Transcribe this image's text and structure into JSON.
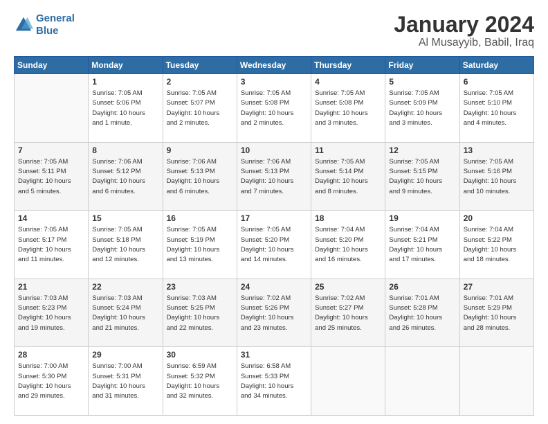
{
  "header": {
    "logo_line1": "General",
    "logo_line2": "Blue",
    "title": "January 2024",
    "subtitle": "Al Musayyib, Babil, Iraq"
  },
  "weekdays": [
    "Sunday",
    "Monday",
    "Tuesday",
    "Wednesday",
    "Thursday",
    "Friday",
    "Saturday"
  ],
  "weeks": [
    [
      {
        "day": "",
        "info": ""
      },
      {
        "day": "1",
        "info": "Sunrise: 7:05 AM\nSunset: 5:06 PM\nDaylight: 10 hours\nand 1 minute."
      },
      {
        "day": "2",
        "info": "Sunrise: 7:05 AM\nSunset: 5:07 PM\nDaylight: 10 hours\nand 2 minutes."
      },
      {
        "day": "3",
        "info": "Sunrise: 7:05 AM\nSunset: 5:08 PM\nDaylight: 10 hours\nand 2 minutes."
      },
      {
        "day": "4",
        "info": "Sunrise: 7:05 AM\nSunset: 5:08 PM\nDaylight: 10 hours\nand 3 minutes."
      },
      {
        "day": "5",
        "info": "Sunrise: 7:05 AM\nSunset: 5:09 PM\nDaylight: 10 hours\nand 3 minutes."
      },
      {
        "day": "6",
        "info": "Sunrise: 7:05 AM\nSunset: 5:10 PM\nDaylight: 10 hours\nand 4 minutes."
      }
    ],
    [
      {
        "day": "7",
        "info": "Sunrise: 7:05 AM\nSunset: 5:11 PM\nDaylight: 10 hours\nand 5 minutes."
      },
      {
        "day": "8",
        "info": "Sunrise: 7:06 AM\nSunset: 5:12 PM\nDaylight: 10 hours\nand 6 minutes."
      },
      {
        "day": "9",
        "info": "Sunrise: 7:06 AM\nSunset: 5:13 PM\nDaylight: 10 hours\nand 6 minutes."
      },
      {
        "day": "10",
        "info": "Sunrise: 7:06 AM\nSunset: 5:13 PM\nDaylight: 10 hours\nand 7 minutes."
      },
      {
        "day": "11",
        "info": "Sunrise: 7:05 AM\nSunset: 5:14 PM\nDaylight: 10 hours\nand 8 minutes."
      },
      {
        "day": "12",
        "info": "Sunrise: 7:05 AM\nSunset: 5:15 PM\nDaylight: 10 hours\nand 9 minutes."
      },
      {
        "day": "13",
        "info": "Sunrise: 7:05 AM\nSunset: 5:16 PM\nDaylight: 10 hours\nand 10 minutes."
      }
    ],
    [
      {
        "day": "14",
        "info": "Sunrise: 7:05 AM\nSunset: 5:17 PM\nDaylight: 10 hours\nand 11 minutes."
      },
      {
        "day": "15",
        "info": "Sunrise: 7:05 AM\nSunset: 5:18 PM\nDaylight: 10 hours\nand 12 minutes."
      },
      {
        "day": "16",
        "info": "Sunrise: 7:05 AM\nSunset: 5:19 PM\nDaylight: 10 hours\nand 13 minutes."
      },
      {
        "day": "17",
        "info": "Sunrise: 7:05 AM\nSunset: 5:20 PM\nDaylight: 10 hours\nand 14 minutes."
      },
      {
        "day": "18",
        "info": "Sunrise: 7:04 AM\nSunset: 5:20 PM\nDaylight: 10 hours\nand 16 minutes."
      },
      {
        "day": "19",
        "info": "Sunrise: 7:04 AM\nSunset: 5:21 PM\nDaylight: 10 hours\nand 17 minutes."
      },
      {
        "day": "20",
        "info": "Sunrise: 7:04 AM\nSunset: 5:22 PM\nDaylight: 10 hours\nand 18 minutes."
      }
    ],
    [
      {
        "day": "21",
        "info": "Sunrise: 7:03 AM\nSunset: 5:23 PM\nDaylight: 10 hours\nand 19 minutes."
      },
      {
        "day": "22",
        "info": "Sunrise: 7:03 AM\nSunset: 5:24 PM\nDaylight: 10 hours\nand 21 minutes."
      },
      {
        "day": "23",
        "info": "Sunrise: 7:03 AM\nSunset: 5:25 PM\nDaylight: 10 hours\nand 22 minutes."
      },
      {
        "day": "24",
        "info": "Sunrise: 7:02 AM\nSunset: 5:26 PM\nDaylight: 10 hours\nand 23 minutes."
      },
      {
        "day": "25",
        "info": "Sunrise: 7:02 AM\nSunset: 5:27 PM\nDaylight: 10 hours\nand 25 minutes."
      },
      {
        "day": "26",
        "info": "Sunrise: 7:01 AM\nSunset: 5:28 PM\nDaylight: 10 hours\nand 26 minutes."
      },
      {
        "day": "27",
        "info": "Sunrise: 7:01 AM\nSunset: 5:29 PM\nDaylight: 10 hours\nand 28 minutes."
      }
    ],
    [
      {
        "day": "28",
        "info": "Sunrise: 7:00 AM\nSunset: 5:30 PM\nDaylight: 10 hours\nand 29 minutes."
      },
      {
        "day": "29",
        "info": "Sunrise: 7:00 AM\nSunset: 5:31 PM\nDaylight: 10 hours\nand 31 minutes."
      },
      {
        "day": "30",
        "info": "Sunrise: 6:59 AM\nSunset: 5:32 PM\nDaylight: 10 hours\nand 32 minutes."
      },
      {
        "day": "31",
        "info": "Sunrise: 6:58 AM\nSunset: 5:33 PM\nDaylight: 10 hours\nand 34 minutes."
      },
      {
        "day": "",
        "info": ""
      },
      {
        "day": "",
        "info": ""
      },
      {
        "day": "",
        "info": ""
      }
    ]
  ]
}
